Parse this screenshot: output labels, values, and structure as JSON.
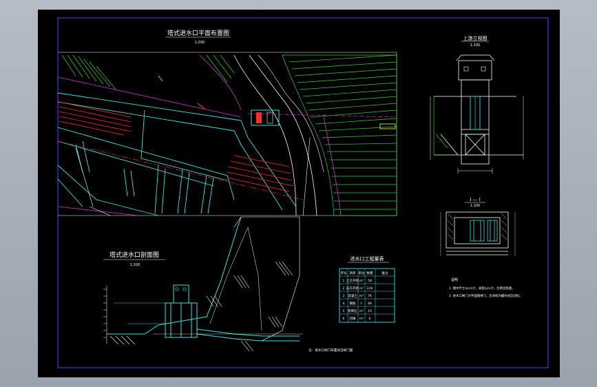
{
  "plan": {
    "title": "塔式进水口平面布置图",
    "scale": "1:200"
  },
  "section": {
    "title": "塔式进水口剖面图",
    "scale": "1:200"
  },
  "elevation": {
    "title": "上游立视图",
    "scale": "1:100"
  },
  "cut": {
    "label": "I — I",
    "scale": "1:100"
  },
  "table": {
    "title": "进水口工程量表",
    "headers": [
      "序号",
      "项目",
      "单位",
      "数量",
      "备注"
    ],
    "rows": [
      [
        "1",
        "土方开挖",
        "m³",
        "58",
        ""
      ],
      [
        "2",
        "石方开挖",
        "m³",
        "226",
        ""
      ],
      [
        "3",
        "混凝土",
        "m³",
        "76",
        ""
      ],
      [
        "4",
        "钢筋",
        "t",
        "84",
        ""
      ],
      [
        "5",
        "浆砌石",
        "m³",
        "15",
        ""
      ],
      [
        "6",
        "回填",
        "m³",
        "6",
        ""
      ]
    ]
  },
  "notes": {
    "head": "说明",
    "items": [
      "1. 图中尺寸以cm计，高程以m计，比例见各图。",
      "2. 进水口闸门为平面钢闸门，启闭机为螺杆式启闭机。"
    ]
  },
  "footnote": "注：进水口闸门布置详见闸门图",
  "colors": {
    "bg": "#000000",
    "border": "#3a4cff",
    "cyan": "#33e6e6",
    "green": "#2ad62a",
    "magenta": "#d033d0",
    "red": "#ff2a2a",
    "yellow": "#ffff33",
    "white": "#ffffff"
  }
}
